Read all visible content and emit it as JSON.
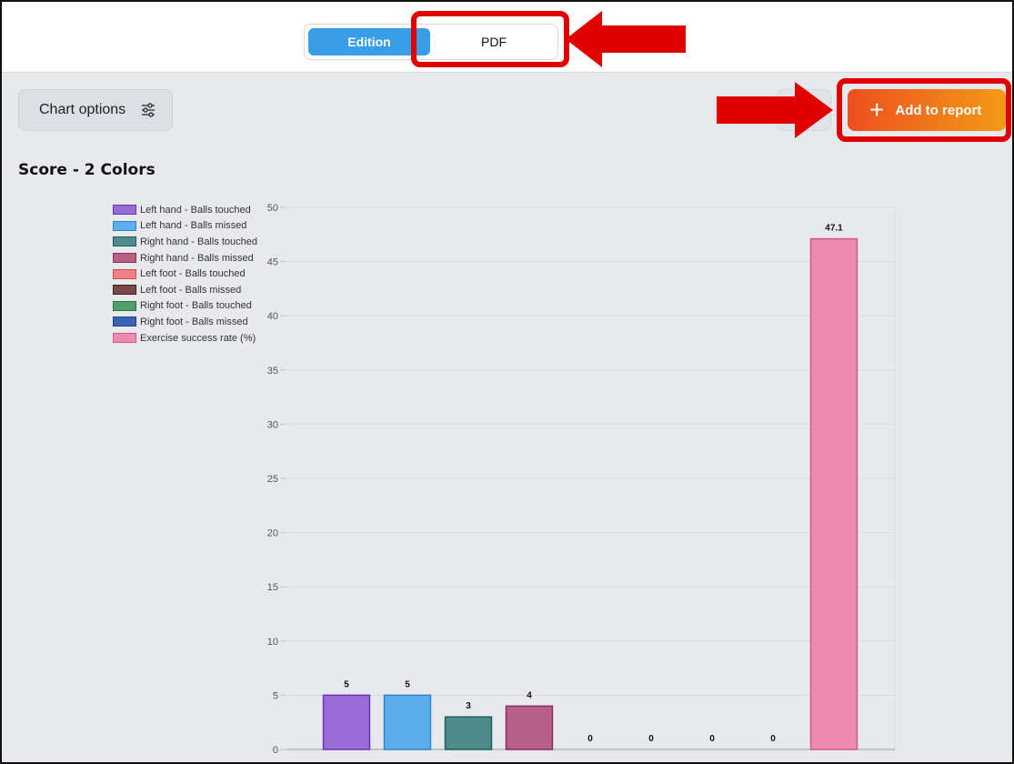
{
  "toggle": {
    "edition_label": "Edition",
    "pdf_label": "PDF"
  },
  "toolbar": {
    "chart_options_label": "Chart options",
    "add_to_report_label": "Add to report"
  },
  "icons": {
    "chart_options": "sliders-icon",
    "add": "plus-icon",
    "annotation": "red-arrow-icon"
  },
  "colors": {
    "accent_blue": "#3a9ee6",
    "accent_orange_start": "#ee4f1f",
    "accent_orange_end": "#f29b16",
    "highlight_red": "#e00000"
  },
  "chart_data": {
    "type": "bar",
    "title": "Score - 2 Colors",
    "ylim": [
      0,
      50
    ],
    "yticks": [
      0,
      5,
      10,
      15,
      20,
      25,
      30,
      35,
      40,
      45,
      50
    ],
    "grid": true,
    "legend_position": "top-left",
    "series": [
      {
        "name": "Left hand - Balls touched",
        "value": 5,
        "label": "5",
        "fill": "#9a6cd6",
        "stroke": "#6a32b8"
      },
      {
        "name": "Left hand - Balls missed",
        "value": 5,
        "label": "5",
        "fill": "#5daeea",
        "stroke": "#2a86cf"
      },
      {
        "name": "Right hand - Balls touched",
        "value": 3,
        "label": "3",
        "fill": "#4f8b8b",
        "stroke": "#1f5c5c"
      },
      {
        "name": "Right hand - Balls missed",
        "value": 4,
        "label": "4",
        "fill": "#b76088",
        "stroke": "#8a2f5a"
      },
      {
        "name": "Left foot - Balls touched",
        "value": 0,
        "label": "0",
        "fill": "#f07f86",
        "stroke": "#d44a55"
      },
      {
        "name": "Left foot - Balls missed",
        "value": 0,
        "label": "0",
        "fill": "#7a4a4a",
        "stroke": "#3d1f1f"
      },
      {
        "name": "Right foot - Balls touched",
        "value": 0,
        "label": "0",
        "fill": "#4f9f6b",
        "stroke": "#2a7444"
      },
      {
        "name": "Right foot - Balls missed",
        "value": 0,
        "label": "0",
        "fill": "#3c62b8",
        "stroke": "#203f8a"
      },
      {
        "name": "Exercise success rate (%)",
        "value": 47.1,
        "label": "47.1",
        "fill": "#ec8bae",
        "stroke": "#d65486"
      }
    ]
  }
}
